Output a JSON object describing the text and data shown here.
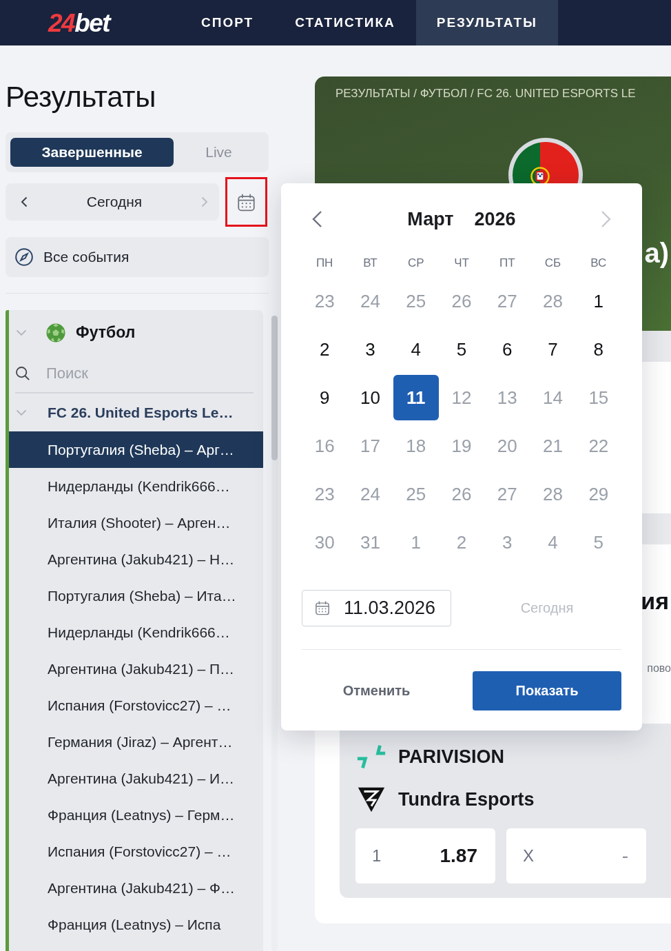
{
  "header": {
    "logo": {
      "number": "24",
      "word": "bet"
    },
    "nav": [
      {
        "label": "СПОРТ",
        "selected": false
      },
      {
        "label": "СТАТИСТИКА",
        "selected": false
      },
      {
        "label": "РЕЗУЛЬТАТЫ",
        "selected": true
      }
    ]
  },
  "sidebar": {
    "title": "Результаты",
    "tabs": [
      {
        "label": "Завершенные",
        "selected": true
      },
      {
        "label": "Live",
        "selected": false
      }
    ],
    "date_nav": {
      "label": "Сегодня",
      "prev_disabled": false,
      "next_disabled": true,
      "calendar_highlighted": true
    },
    "all_events": {
      "label": "Все события"
    },
    "sport": {
      "name": "Футбол",
      "expanded": true,
      "search": {
        "placeholder": "Поиск"
      },
      "leagues": [
        {
          "name": "FC 26. United Esports Le…",
          "expanded": true,
          "children": [
            {
              "label": "Португалия (Sheba) – Арг…",
              "selected": true
            },
            {
              "label": "Нидерланды (Kendrik666…",
              "selected": false
            },
            {
              "label": "Италия (Shooter) – Арген…",
              "selected": false
            },
            {
              "label": "Аргентина (Jakub421) – Н…",
              "selected": false
            },
            {
              "label": "Португалия (Sheba) – Ита…",
              "selected": false
            },
            {
              "label": "Нидерланды (Kendrik666…",
              "selected": false
            },
            {
              "label": "Аргентина (Jakub421) – П…",
              "selected": false
            },
            {
              "label": "Испания (Forstovicc27) – …",
              "selected": false
            },
            {
              "label": "Германия (Jiraz) – Аргент…",
              "selected": false
            },
            {
              "label": "Аргентина (Jakub421) – И…",
              "selected": false
            },
            {
              "label": "Франция (Leatnys) – Герм…",
              "selected": false
            },
            {
              "label": "Испания (Forstovicc27) – …",
              "selected": false
            },
            {
              "label": "Аргентина (Jakub421) – Ф…",
              "selected": false
            },
            {
              "label": "Франция (Leatnys) – Испа",
              "selected": false
            }
          ]
        }
      ]
    }
  },
  "main": {
    "breadcrumb": "РЕЗУЛЬТАТЫ / ФУТБОЛ / FC 26. UNITED ESPORTS LE",
    "match_title": "а)",
    "section_title": "ия",
    "section_note": "пово",
    "event": {
      "teams": [
        {
          "name": "PARIVISION",
          "kind": "arrows"
        },
        {
          "name": "Tundra Esports",
          "kind": "triangle"
        }
      ],
      "odds": [
        {
          "label": "1",
          "value": "1.87",
          "disabled": false
        },
        {
          "label": "X",
          "value": "-",
          "disabled": true
        }
      ]
    }
  },
  "date_picker": {
    "month": "Март",
    "year": "2026",
    "prev_disabled": false,
    "next_disabled": true,
    "weekdays": [
      "ПН",
      "ВТ",
      "СР",
      "ЧТ",
      "ПТ",
      "СБ",
      "ВС"
    ],
    "weeks": [
      [
        {
          "day": "23",
          "dimmed": true,
          "selected": false
        },
        {
          "day": "24",
          "dimmed": true,
          "selected": false
        },
        {
          "day": "25",
          "dimmed": true,
          "selected": false
        },
        {
          "day": "26",
          "dimmed": true,
          "selected": false
        },
        {
          "day": "27",
          "dimmed": true,
          "selected": false
        },
        {
          "day": "28",
          "dimmed": true,
          "selected": false
        },
        {
          "day": "1",
          "dimmed": false,
          "selected": false
        }
      ],
      [
        {
          "day": "2",
          "dimmed": false,
          "selected": false
        },
        {
          "day": "3",
          "dimmed": false,
          "selected": false
        },
        {
          "day": "4",
          "dimmed": false,
          "selected": false
        },
        {
          "day": "5",
          "dimmed": false,
          "selected": false
        },
        {
          "day": "6",
          "dimmed": false,
          "selected": false
        },
        {
          "day": "7",
          "dimmed": false,
          "selected": false
        },
        {
          "day": "8",
          "dimmed": false,
          "selected": false
        }
      ],
      [
        {
          "day": "9",
          "dimmed": false,
          "selected": false
        },
        {
          "day": "10",
          "dimmed": false,
          "selected": false
        },
        {
          "day": "11",
          "dimmed": false,
          "selected": true
        },
        {
          "day": "12",
          "dimmed": true,
          "selected": false
        },
        {
          "day": "13",
          "dimmed": true,
          "selected": false
        },
        {
          "day": "14",
          "dimmed": true,
          "selected": false
        },
        {
          "day": "15",
          "dimmed": true,
          "selected": false
        }
      ],
      [
        {
          "day": "16",
          "dimmed": true,
          "selected": false
        },
        {
          "day": "17",
          "dimmed": true,
          "selected": false
        },
        {
          "day": "18",
          "dimmed": true,
          "selected": false
        },
        {
          "day": "19",
          "dimmed": true,
          "selected": false
        },
        {
          "day": "20",
          "dimmed": true,
          "selected": false
        },
        {
          "day": "21",
          "dimmed": true,
          "selected": false
        },
        {
          "day": "22",
          "dimmed": true,
          "selected": false
        }
      ],
      [
        {
          "day": "23",
          "dimmed": true,
          "selected": false
        },
        {
          "day": "24",
          "dimmed": true,
          "selected": false
        },
        {
          "day": "25",
          "dimmed": true,
          "selected": false
        },
        {
          "day": "26",
          "dimmed": true,
          "selected": false
        },
        {
          "day": "27",
          "dimmed": true,
          "selected": false
        },
        {
          "day": "28",
          "dimmed": true,
          "selected": false
        },
        {
          "day": "29",
          "dimmed": true,
          "selected": false
        }
      ],
      [
        {
          "day": "30",
          "dimmed": true,
          "selected": false
        },
        {
          "day": "31",
          "dimmed": true,
          "selected": false
        },
        {
          "day": "1",
          "dimmed": true,
          "selected": false
        },
        {
          "day": "2",
          "dimmed": true,
          "selected": false
        },
        {
          "day": "3",
          "dimmed": true,
          "selected": false
        },
        {
          "day": "4",
          "dimmed": true,
          "selected": false
        },
        {
          "day": "5",
          "dimmed": true,
          "selected": false
        }
      ]
    ],
    "date_input": {
      "value": "11.03.2026"
    },
    "today": {
      "label": "Сегодня",
      "disabled": true
    },
    "cancel": "Отменить",
    "confirm": "Показать"
  }
}
